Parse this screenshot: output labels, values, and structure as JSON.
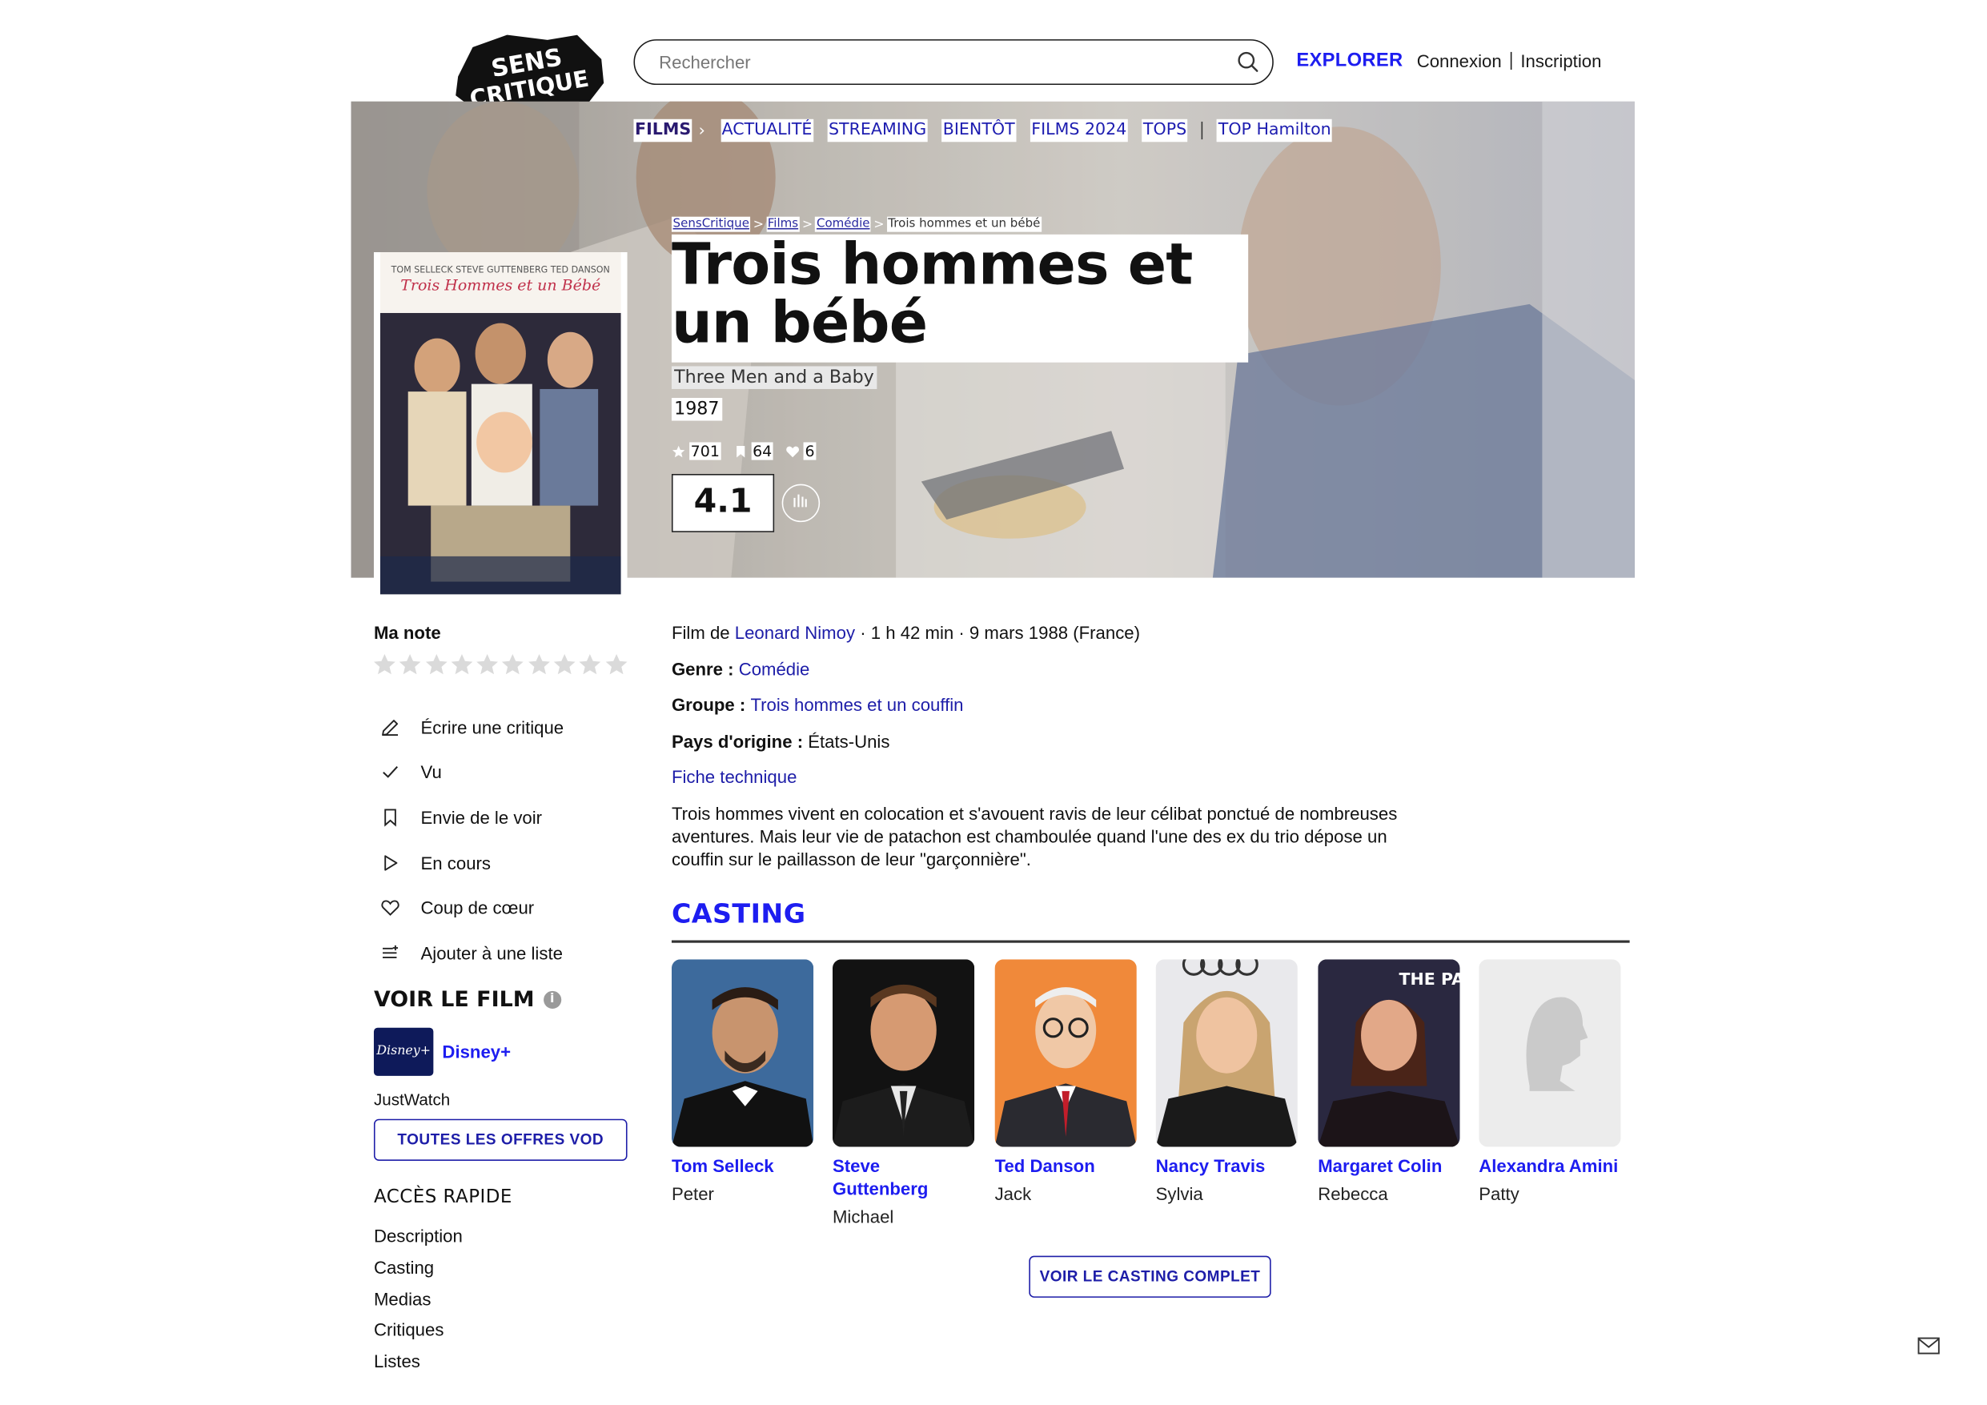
{
  "header": {
    "logo_text": [
      "SENS",
      "CRITIQUE"
    ],
    "search_placeholder": "Rechercher",
    "explore_label": "EXPLORER",
    "login_label": "Connexion",
    "signup_label": "Inscription"
  },
  "nav": {
    "items": [
      "FILMS",
      "ACTUALITÉ",
      "STREAMING",
      "BIENTÔT",
      "FILMS 2024",
      "TOPS",
      "TOP Hamilton"
    ]
  },
  "breadcrumb": [
    "SensCritique",
    "Films",
    "Comédie",
    "Trois hommes et un bébé"
  ],
  "film": {
    "title": "Trois hommes et un bébé",
    "original_title": "Three Men and a Baby",
    "year": "1987",
    "stats": {
      "ratings": "701",
      "wishlist": "64",
      "favorites": "6"
    },
    "rating": "4.1",
    "poster_text": {
      "actors": "TOM SELLECK   STEVE GUTTENBERG   TED DANSON",
      "title": "Trois Hommes et un Bébé"
    }
  },
  "sidebar": {
    "my_rating_label": "Ma note",
    "star_count": 10,
    "actions": [
      "Écrire une critique",
      "Vu",
      "Envie de le voir",
      "En cours",
      "Coup de cœur",
      "Ajouter à une liste"
    ],
    "watch_title": "VOIR LE FILM",
    "provider": {
      "name": "Disney+",
      "logo_text": "Disney+"
    },
    "justwatch_label": "JustWatch",
    "vod_button": "TOUTES LES OFFRES VOD",
    "quick_title": "ACCÈS RAPIDE",
    "quick_links": [
      "Description",
      "Casting",
      "Medias",
      "Critiques",
      "Listes"
    ]
  },
  "details": {
    "film_by_prefix": "Film de ",
    "director": "Leonard Nimoy",
    "meta": " · 1 h 42 min · 9 mars 1988 (France)",
    "genre_label": "Genre : ",
    "genre": "Comédie",
    "group_label": "Groupe : ",
    "group": "Trois hommes et un couffin",
    "country_label": "Pays d'origine : ",
    "country": "États-Unis",
    "tech_sheet": "Fiche technique",
    "synopsis": "Trois hommes vivent en colocation et s'avouent ravis de leur célibat ponctué de nombreuses aventures. Mais leur vie de patachon est chamboulée quand l'une des ex du trio dépose un couffin sur le paillasson de leur \"garçonnière\"."
  },
  "casting": {
    "title": "CASTING",
    "members": [
      {
        "actor": "Tom Selleck",
        "role": "Peter"
      },
      {
        "actor": "Steve Guttenberg",
        "role": "Michael"
      },
      {
        "actor": "Ted Danson",
        "role": "Jack"
      },
      {
        "actor": "Nancy Travis",
        "role": "Sylvia"
      },
      {
        "actor": "Margaret Colin",
        "role": "Rebecca"
      },
      {
        "actor": "Alexandra Amini",
        "role": "Patty"
      }
    ],
    "photo_backdrop_text": "THE PA",
    "button": "VOIR LE CASTING COMPLET"
  },
  "colors": {
    "accent": "#1d1df0",
    "link": "#1d1da8",
    "text": "#111111"
  }
}
